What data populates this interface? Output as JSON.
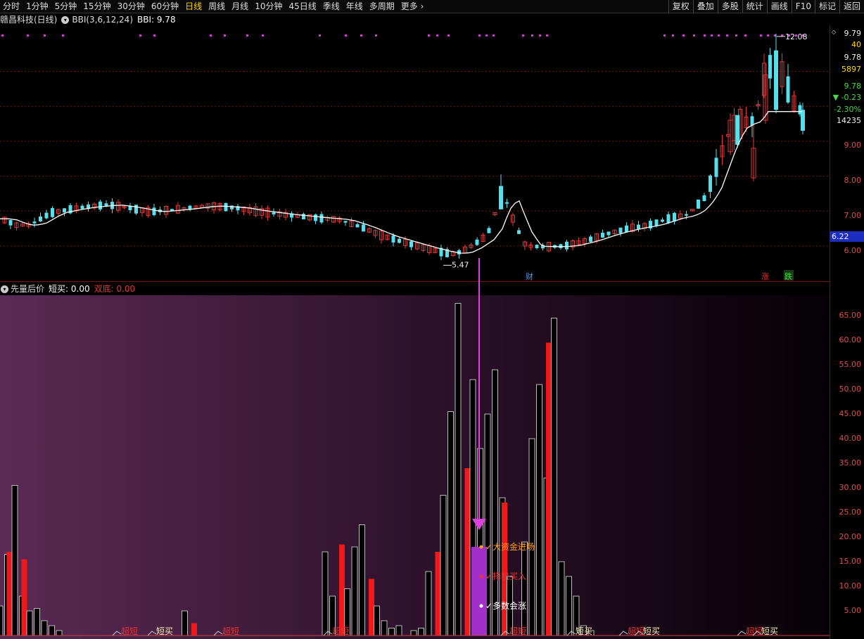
{
  "toolbar": {
    "tabs": [
      "分时",
      "1分钟",
      "5分钟",
      "15分钟",
      "30分钟",
      "60分钟",
      "日线",
      "周线",
      "月线",
      "10分钟",
      "45日线",
      "季线",
      "年线",
      "多周期",
      "更多 ›"
    ],
    "active_tab": "日线",
    "right_buttons": [
      "复权",
      "叠加",
      "多股",
      "统计",
      "画线",
      "F10",
      "标记",
      "返回"
    ]
  },
  "main_panel": {
    "title": "赣昌科技(日线)",
    "indicator": "BBI(3,6,12,24)",
    "indicator_value_label": "BBI: 9.78",
    "price_axis": [
      "9.00",
      "8.00",
      "7.00",
      "6.00"
    ],
    "right_info": [
      "9.79",
      "40",
      "9.78",
      "5897",
      "9.78",
      "-0.23",
      "-2.30%",
      "14235"
    ],
    "highlight_price": "6.22",
    "low_label": "5.47",
    "high_label": "12.08",
    "markers": {
      "cai": "财",
      "zhang": "涨",
      "die": "跌"
    }
  },
  "sub_panel": {
    "title": "先量后价",
    "short_buy_label": "短买: 0.00",
    "double_bottom_label": "双底: 0.00",
    "axis": [
      "65.00",
      "60.00",
      "55.00",
      "50.00",
      "45.00",
      "40.00",
      "35.00",
      "30.00",
      "25.00",
      "20.00",
      "15.00",
      "10.00",
      "5.00"
    ],
    "annotations": [
      "大资金进场",
      "择机买入",
      "多数会涨"
    ],
    "signals": [
      "短买",
      "超短"
    ]
  },
  "chart_data": {
    "type": "bar",
    "title": "先量后价",
    "ylim": [
      0,
      68
    ],
    "series": [
      {
        "name": "black",
        "values": [
          6,
          16.5,
          30.5,
          8,
          5,
          5.5,
          3,
          2,
          1,
          0,
          0,
          0,
          0,
          0,
          0,
          0,
          0,
          0,
          0,
          0,
          0,
          0,
          0,
          0,
          0,
          5,
          0,
          0,
          0,
          0,
          0,
          0,
          0,
          0,
          0,
          0,
          0,
          0,
          0,
          0,
          0,
          0,
          0,
          0,
          17,
          8,
          0,
          9.5,
          18,
          22.5,
          0,
          6,
          3,
          1.5,
          2,
          0,
          1,
          1.5,
          13,
          0,
          28.5,
          45.5,
          67.5,
          0,
          52,
          38,
          45,
          54,
          28,
          12,
          0,
          19,
          40,
          51,
          32,
          64.5,
          15,
          12,
          8,
          2,
          1
        ]
      },
      {
        "name": "red",
        "values": [
          0,
          17,
          0,
          15.5,
          0,
          0,
          0,
          0,
          0,
          0,
          0,
          0,
          0,
          0,
          0,
          0,
          0,
          0,
          0,
          0,
          0,
          0,
          0,
          0,
          0,
          0,
          2.5,
          0,
          0,
          0,
          0,
          0,
          0,
          0,
          0,
          0,
          0,
          0,
          0,
          0,
          0,
          0,
          0,
          0,
          0,
          0,
          18.5,
          0,
          0,
          0,
          11.5,
          0,
          0,
          0,
          0,
          0,
          0,
          0,
          0,
          17,
          0,
          0,
          0,
          34,
          0,
          0,
          0,
          0,
          27,
          0,
          0,
          0,
          0,
          0,
          59.5,
          0,
          0,
          0,
          0,
          0,
          0
        ]
      }
    ]
  },
  "colors": {
    "up": "#e23838",
    "down": "#55e0ee",
    "bbi": "#ffffff",
    "grid": "#7a1212",
    "accent": "#e040e0",
    "purple_bar": "#a22fc9"
  }
}
